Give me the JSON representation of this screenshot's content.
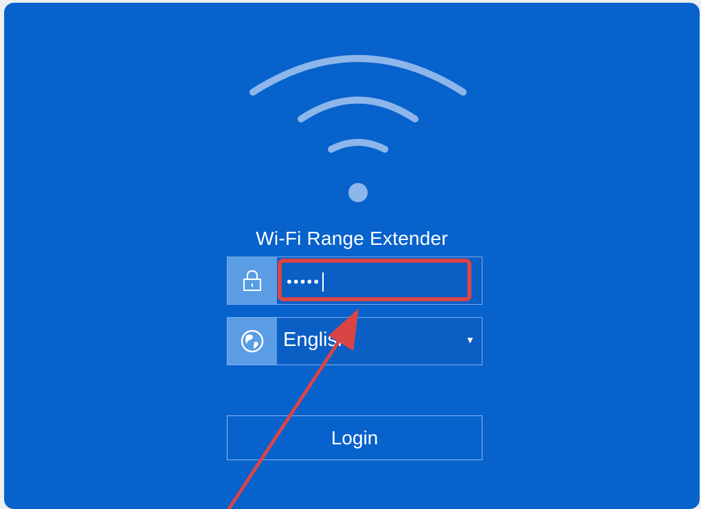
{
  "app": {
    "title": "Wi-Fi Range Extender"
  },
  "login_form": {
    "password": {
      "icon": "lock-icon",
      "value": "•••••"
    },
    "language": {
      "icon": "globe-icon",
      "selected": "English",
      "dropdown_icon": "dropdown-arrow-icon"
    },
    "login_label": "Login"
  },
  "annotation": {
    "highlight_color": "#d94545",
    "arrow_color": "#d94545"
  },
  "colors": {
    "panel_background": "#0762cc",
    "icon_tile": "#5a9de4",
    "text": "#ffffff"
  }
}
